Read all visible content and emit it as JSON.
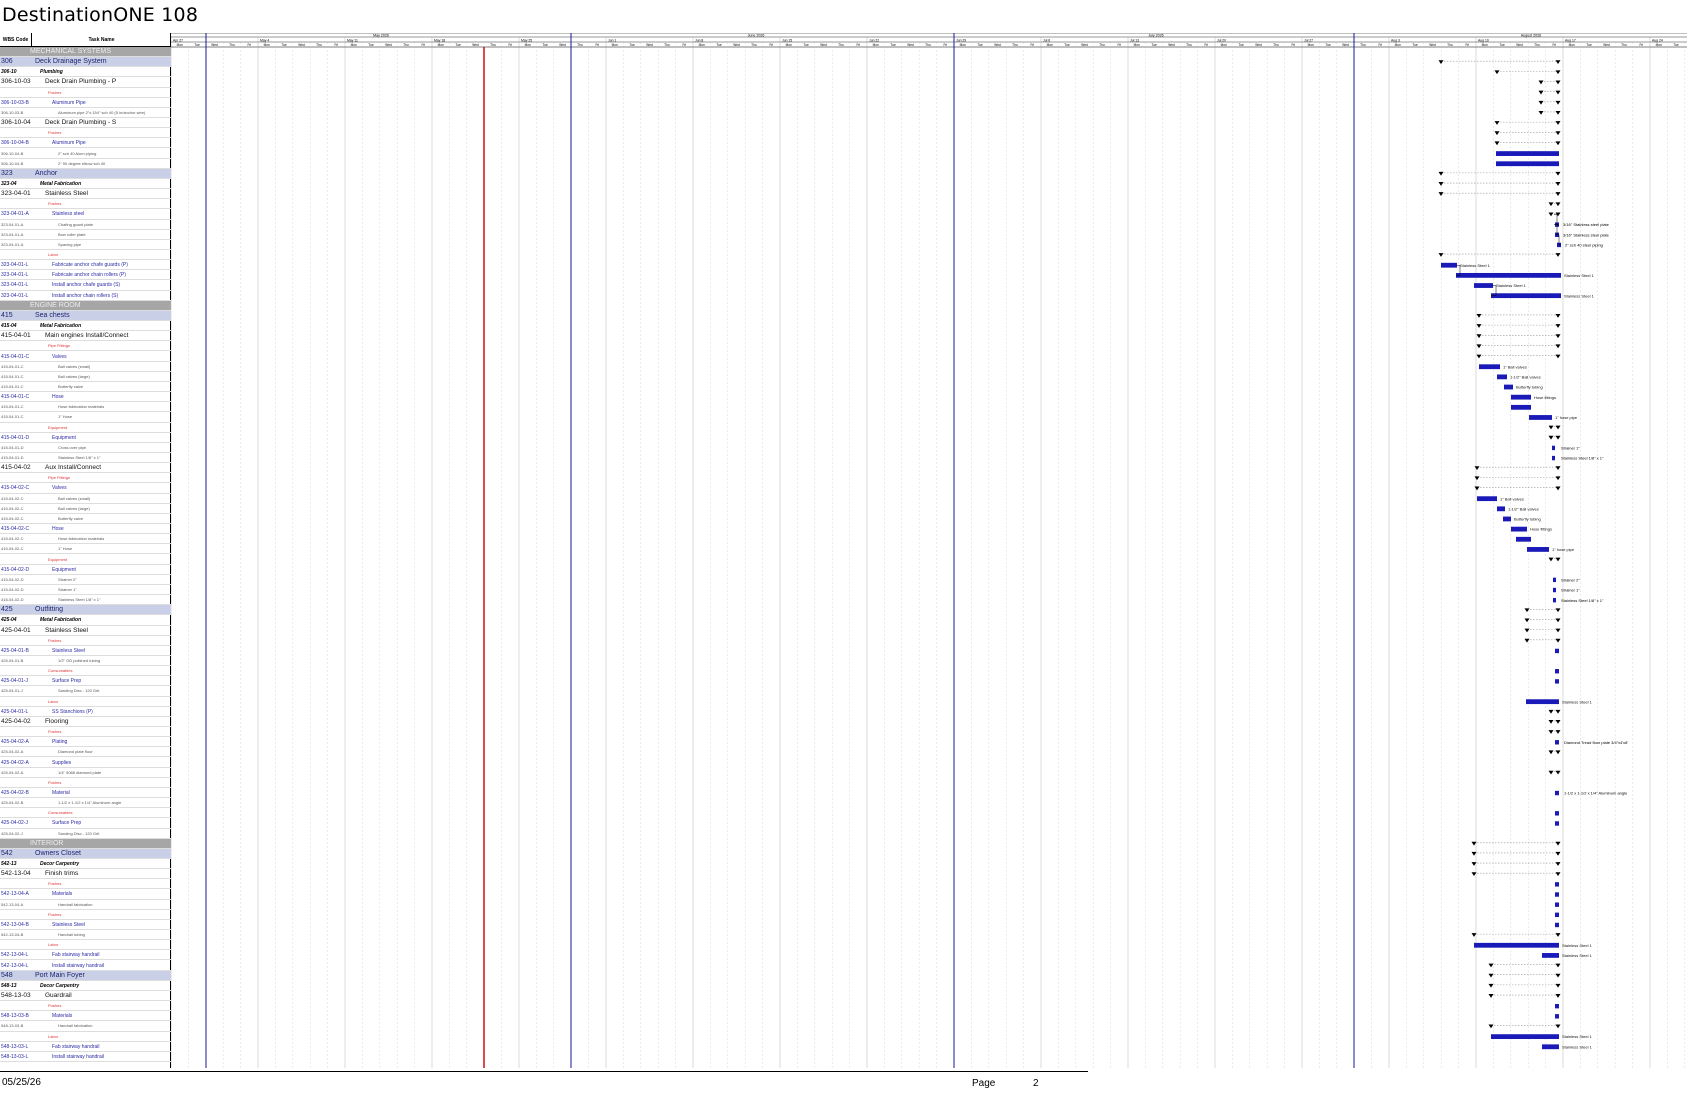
{
  "title": "DestinationONE 108",
  "columns": {
    "code": "WBS Code",
    "name": "Task Name"
  },
  "months": [
    "May 2026",
    "June 2026",
    "July 2026",
    "August 2026"
  ],
  "weeks": [
    "Apr 27",
    "May 4",
    "May 11",
    "May 18",
    "May 25",
    "Jun 1",
    "Jun 8",
    "Jun 15",
    "Jun 22",
    "Jun 29",
    "Jul 6",
    "Jul 13",
    "Jul 20",
    "Jul 27",
    "Aug 3",
    "Aug 10",
    "Aug 17",
    "Aug 24"
  ],
  "days": [
    "Mon",
    "Tue",
    "Wed",
    "Thu",
    "Fri"
  ],
  "rows": [
    {
      "type": "section",
      "code": "",
      "name": "MECHANICAL SYSTEMS"
    },
    {
      "type": "system",
      "code": "306",
      "name": "Deck Drainage System"
    },
    {
      "type": "cat",
      "code": "306-10",
      "name": "Plumbing"
    },
    {
      "type": "item",
      "code": "306-10-03",
      "name": "Deck Drain Plumbing - P"
    },
    {
      "type": "phase",
      "code": "",
      "name": "Pushes"
    },
    {
      "type": "material",
      "code": "306-10-03-B",
      "name": "Aluminum Pipe"
    },
    {
      "type": "detail",
      "code": "306-10-03-B",
      "name": "Aluminum pipe 2\"x.154\" sch 40 (5 in/anchor wire)"
    },
    {
      "type": "item",
      "code": "306-10-04",
      "name": "Deck Drain Plumbing - S"
    },
    {
      "type": "phase",
      "code": "",
      "name": "Pushes"
    },
    {
      "type": "material",
      "code": "306-10-04-B",
      "name": "Aluminum Pipe"
    },
    {
      "type": "detail",
      "code": "306-10-04-B",
      "name": "2\" sch 40 Alum piping"
    },
    {
      "type": "detail",
      "code": "306-10-04-B",
      "name": "2\" 90 degree elbow sch 40"
    },
    {
      "type": "system",
      "code": "323",
      "name": "Anchor"
    },
    {
      "type": "cat",
      "code": "323-04",
      "name": "Metal Fabrication"
    },
    {
      "type": "item",
      "code": "323-04-01",
      "name": "Stainless Steel"
    },
    {
      "type": "phase",
      "code": "",
      "name": "Pushes"
    },
    {
      "type": "material",
      "code": "323-04-01-A",
      "name": "Stainless steel"
    },
    {
      "type": "detail",
      "code": "323-04-01-A",
      "name": "Chafing guard plate"
    },
    {
      "type": "detail",
      "code": "323-04-01-A",
      "name": "Bow roller plate"
    },
    {
      "type": "detail",
      "code": "323-04-01-A",
      "name": "Spacing pipe"
    },
    {
      "type": "phase",
      "code": "",
      "name": "Labor"
    },
    {
      "type": "task",
      "code": "323-04-01-L",
      "name": "Fabricate anchor chafe guards (P)"
    },
    {
      "type": "task",
      "code": "323-04-01-L",
      "name": "Fabricate anchor chain rollers (P)"
    },
    {
      "type": "task",
      "code": "323-04-01-L",
      "name": "Install anchor chafe guards (S)"
    },
    {
      "type": "task",
      "code": "323-04-01-L",
      "name": "Install anchor chain rollers (S)"
    },
    {
      "type": "section",
      "code": "",
      "name": "ENGINE ROOM"
    },
    {
      "type": "system",
      "code": "415",
      "name": "Sea chests"
    },
    {
      "type": "cat",
      "code": "415-04",
      "name": "Metal Fabrication"
    },
    {
      "type": "item",
      "code": "415-04-01",
      "name": "Main engines Install/Connect"
    },
    {
      "type": "phase",
      "code": "",
      "name": "Pipe Fittings"
    },
    {
      "type": "material",
      "code": "415-04-01-C",
      "name": "Valves"
    },
    {
      "type": "detail",
      "code": "415-04-01-C",
      "name": "Ball valves (small)"
    },
    {
      "type": "detail",
      "code": "415-04-01-C",
      "name": "Ball valves (large)"
    },
    {
      "type": "detail",
      "code": "415-04-01-C",
      "name": "Butterfly valve"
    },
    {
      "type": "material",
      "code": "415-04-01-C",
      "name": "Hose"
    },
    {
      "type": "detail",
      "code": "415-04-01-C",
      "name": "Hose fabrication materials"
    },
    {
      "type": "detail",
      "code": "415-04-01-C",
      "name": "1\" Hose"
    },
    {
      "type": "phase",
      "code": "",
      "name": "Equipment"
    },
    {
      "type": "material",
      "code": "415-04-01-D",
      "name": "Equipment"
    },
    {
      "type": "detail",
      "code": "415-04-01-D",
      "name": "Cross over pipe"
    },
    {
      "type": "detail",
      "code": "415-04-01-D",
      "name": "Stainless Steel 1/8\" x 1\""
    },
    {
      "type": "item",
      "code": "415-04-02",
      "name": "Aux Install/Connect"
    },
    {
      "type": "phase",
      "code": "",
      "name": "Pipe Fittings"
    },
    {
      "type": "material",
      "code": "415-04-02-C",
      "name": "Valves"
    },
    {
      "type": "detail",
      "code": "415-04-02-C",
      "name": "Ball valves (small)"
    },
    {
      "type": "detail",
      "code": "415-04-02-C",
      "name": "Ball valves (large)"
    },
    {
      "type": "detail",
      "code": "415-04-02-C",
      "name": "Butterfly valve"
    },
    {
      "type": "material",
      "code": "415-04-02-C",
      "name": "Hose"
    },
    {
      "type": "detail",
      "code": "415-04-02-C",
      "name": "Hose fabrication materials"
    },
    {
      "type": "detail",
      "code": "415-04-02-C",
      "name": "1\" Hose"
    },
    {
      "type": "phase",
      "code": "",
      "name": "Equipment"
    },
    {
      "type": "material",
      "code": "415-04-02-D",
      "name": "Equipment"
    },
    {
      "type": "detail",
      "code": "415-04-02-D",
      "name": "Strainer 2\""
    },
    {
      "type": "detail",
      "code": "415-04-02-D",
      "name": "Strainer 1\""
    },
    {
      "type": "detail",
      "code": "415-04-02-D",
      "name": "Stainless Steel 1/8\" x 1\""
    },
    {
      "type": "system",
      "code": "425",
      "name": "Outfitting"
    },
    {
      "type": "cat",
      "code": "425-04",
      "name": "Metal Fabrication"
    },
    {
      "type": "item",
      "code": "425-04-01",
      "name": "Stainless Steel"
    },
    {
      "type": "phase",
      "code": "",
      "name": "Pushes"
    },
    {
      "type": "material",
      "code": "425-04-01-B",
      "name": "Stainless Steel"
    },
    {
      "type": "detail",
      "code": "425-04-01-B",
      "name": "1/2\" OD polished tubing"
    },
    {
      "type": "phase",
      "code": "",
      "name": "Consumables"
    },
    {
      "type": "material",
      "code": "425-04-01-J",
      "name": "Surface Prep"
    },
    {
      "type": "detail",
      "code": "425-04-01-J",
      "name": "Sanding Disc - 120 Grit"
    },
    {
      "type": "phase",
      "code": "",
      "name": "Labor"
    },
    {
      "type": "task",
      "code": "425-04-01-L",
      "name": "SS Stanchions (P)"
    },
    {
      "type": "item",
      "code": "425-04-02",
      "name": "Flooring"
    },
    {
      "type": "phase",
      "code": "",
      "name": "Pushes"
    },
    {
      "type": "material",
      "code": "425-04-02-A",
      "name": "Plating"
    },
    {
      "type": "detail",
      "code": "425-04-02-A",
      "name": "Diamond plate floor"
    },
    {
      "type": "material",
      "code": "425-04-02-A",
      "name": "Supplies"
    },
    {
      "type": "detail",
      "code": "425-04-02-A",
      "name": "1/4\" 5086 diamond plate"
    },
    {
      "type": "phase",
      "code": "",
      "name": "Pushes"
    },
    {
      "type": "material",
      "code": "425-04-02-B",
      "name": "Material"
    },
    {
      "type": "detail",
      "code": "425-04-02-B",
      "name": "1-1/2 x 1-1/2 x 1/4\" Aluminum angle"
    },
    {
      "type": "phase",
      "code": "",
      "name": "Consumables"
    },
    {
      "type": "material",
      "code": "425-04-02-J",
      "name": "Surface Prep"
    },
    {
      "type": "detail",
      "code": "425-04-02-J",
      "name": "Sanding Disc - 120 Grit"
    },
    {
      "type": "section",
      "code": "",
      "name": "INTERIOR"
    },
    {
      "type": "system",
      "code": "542",
      "name": "Owners Closet"
    },
    {
      "type": "cat",
      "code": "542-13",
      "name": "Decor Carpentry"
    },
    {
      "type": "item",
      "code": "542-13-04",
      "name": "Finish trims"
    },
    {
      "type": "phase",
      "code": "",
      "name": "Pushes"
    },
    {
      "type": "material",
      "code": "542-13-04-A",
      "name": "Materials"
    },
    {
      "type": "detail",
      "code": "542-13-04-A",
      "name": "Handrail fabrication"
    },
    {
      "type": "phase",
      "code": "",
      "name": "Pushes"
    },
    {
      "type": "material",
      "code": "542-13-04-B",
      "name": "Stainless Steel"
    },
    {
      "type": "detail",
      "code": "542-13-04-B",
      "name": "Handrail tubing"
    },
    {
      "type": "phase",
      "code": "",
      "name": "Labor"
    },
    {
      "type": "task",
      "code": "542-13-04-L",
      "name": "Fab stairway handrail"
    },
    {
      "type": "task",
      "code": "542-13-04-L",
      "name": "Install stairway handrail"
    },
    {
      "type": "system",
      "code": "548",
      "name": "Port Main Foyer"
    },
    {
      "type": "cat",
      "code": "548-13",
      "name": "Decor Carpentry"
    },
    {
      "type": "item",
      "code": "548-13-03",
      "name": "Guardrail"
    },
    {
      "type": "phase",
      "code": "",
      "name": "Pushes"
    },
    {
      "type": "material",
      "code": "548-13-03-B",
      "name": "Materials"
    },
    {
      "type": "detail",
      "code": "548-13-03-B",
      "name": "Handrail fabrication"
    },
    {
      "type": "phase",
      "code": "",
      "name": "Labor"
    },
    {
      "type": "task",
      "code": "548-13-03-L",
      "name": "Fab stairway handrail"
    },
    {
      "type": "task",
      "code": "548-13-03-L",
      "name": "Install stairway handrail"
    }
  ],
  "bar_labels": {
    "anchor_steel": "Stainless Steel 1",
    "plate_a": "3/16\" Stainless steel plate",
    "plate_b": "3/16\" Stainless steel plate",
    "pipe": "2\" sch 40 steel piping",
    "ball_small": "1\" Ball valves",
    "ball_large": "1-1/2\" Ball valves",
    "butterfly": "Butterfly tubing",
    "hose_fittings": "Hose fittings",
    "hose_pipe": "1\" hose pipe",
    "strainer": "Strainer 1\"",
    "ss_18": "Stainless Steel 1/8\" x 1\"",
    "strainer2": "Strainer 2\"",
    "diamond": "Diamond Tread floor plate 3/4\"x4'x8'",
    "angle": "1-1/2 x 1-1/2 x 1/4\" Aluminum angle"
  },
  "footer": {
    "date": "05/25/26",
    "page_label": "Page",
    "page_number": "2"
  },
  "colors": {
    "bar": "#1a1ab8",
    "today_line": "#cc0000",
    "month_line": "#1a1a9a",
    "section": "#a6a6a6",
    "system": "#c9cfe6"
  }
}
